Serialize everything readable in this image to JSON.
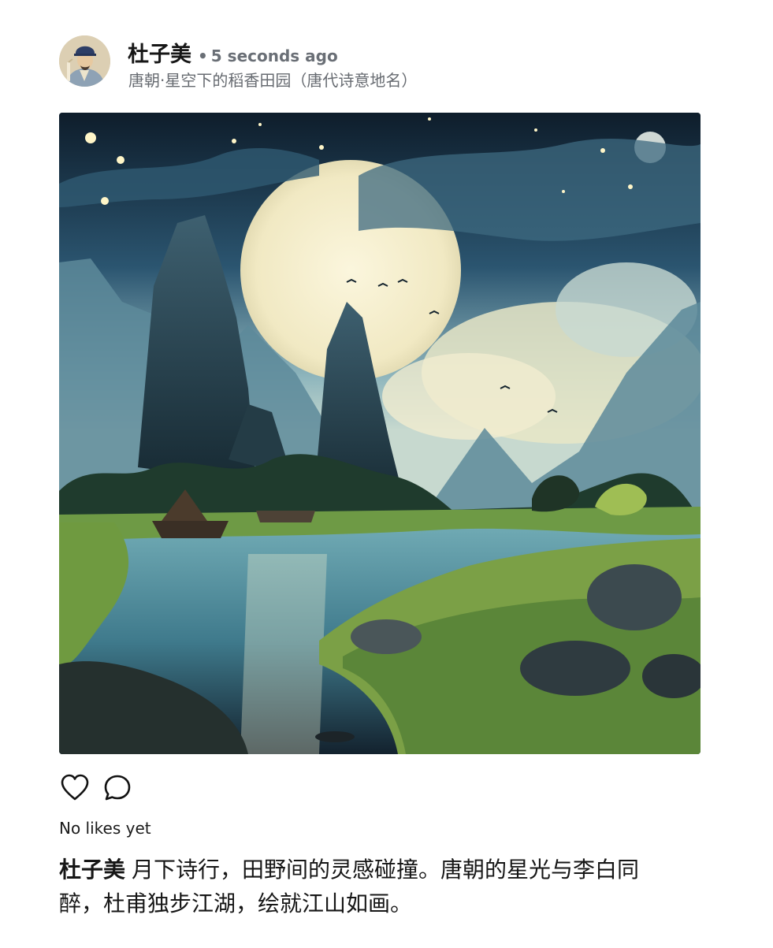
{
  "post": {
    "author": "杜子美",
    "separator": "•",
    "time": "5 seconds ago",
    "location": "唐朝·星空下的稻香田园（唐代诗意地名）",
    "avatar_icon": "tang-poet-avatar",
    "image_icon": "moonlit-mountain-river-painting",
    "likes_text": "No likes yet",
    "caption_author": "杜子美",
    "caption_text": "月下诗行，田野间的灵感碰撞。唐朝的星光与李白同醉，杜甫独步江湖，绘就江山如画。"
  },
  "actions": {
    "like_icon": "heart-icon",
    "comment_icon": "comment-icon"
  },
  "colors": {
    "name": "#161616",
    "meta": "#6a6f76",
    "moon": "#f6efcf",
    "sky": "#1b3a52",
    "water": "#4f93a3",
    "grass": "#8fae4e"
  }
}
